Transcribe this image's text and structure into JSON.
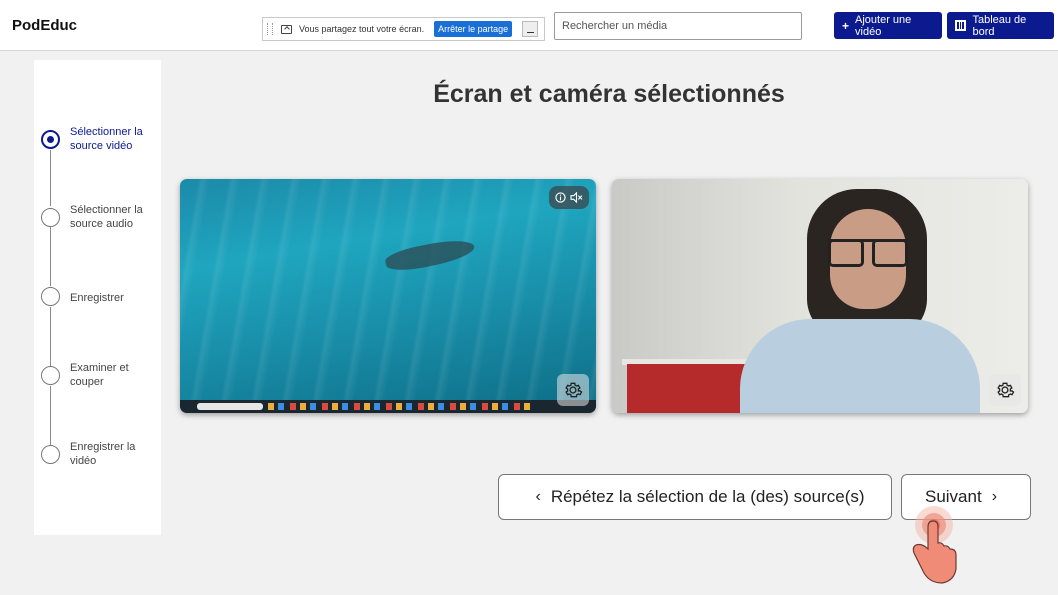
{
  "header": {
    "brand": "PodEduc",
    "share_text": "Vous partagez tout votre écran.",
    "share_stop": "Arrêter le partage",
    "search_placeholder": "Rechercher un média",
    "add_video": "Ajouter une vidéo",
    "dashboard": "Tableau de bord"
  },
  "stepper": {
    "steps": [
      {
        "label": "Sélectionner la source vidéo",
        "active": true
      },
      {
        "label": "Sélectionner la source audio",
        "active": false
      },
      {
        "label": "Enregistrer",
        "active": false
      },
      {
        "label": "Examiner et couper",
        "active": false
      },
      {
        "label": "Enregistrer la vidéo",
        "active": false
      }
    ]
  },
  "main": {
    "title": "Écran et caméra sélectionnés",
    "back_label": "Répétez la sélection de la (des) source(s)",
    "next_label": "Suivant"
  },
  "colors": {
    "accent": "#0b1b8f"
  },
  "icons": [
    "plus-icon",
    "film-icon",
    "share-icon",
    "info-icon",
    "mute-icon",
    "gear-icon",
    "chevron-left-icon",
    "chevron-right-icon",
    "pointer-hand-icon"
  ]
}
